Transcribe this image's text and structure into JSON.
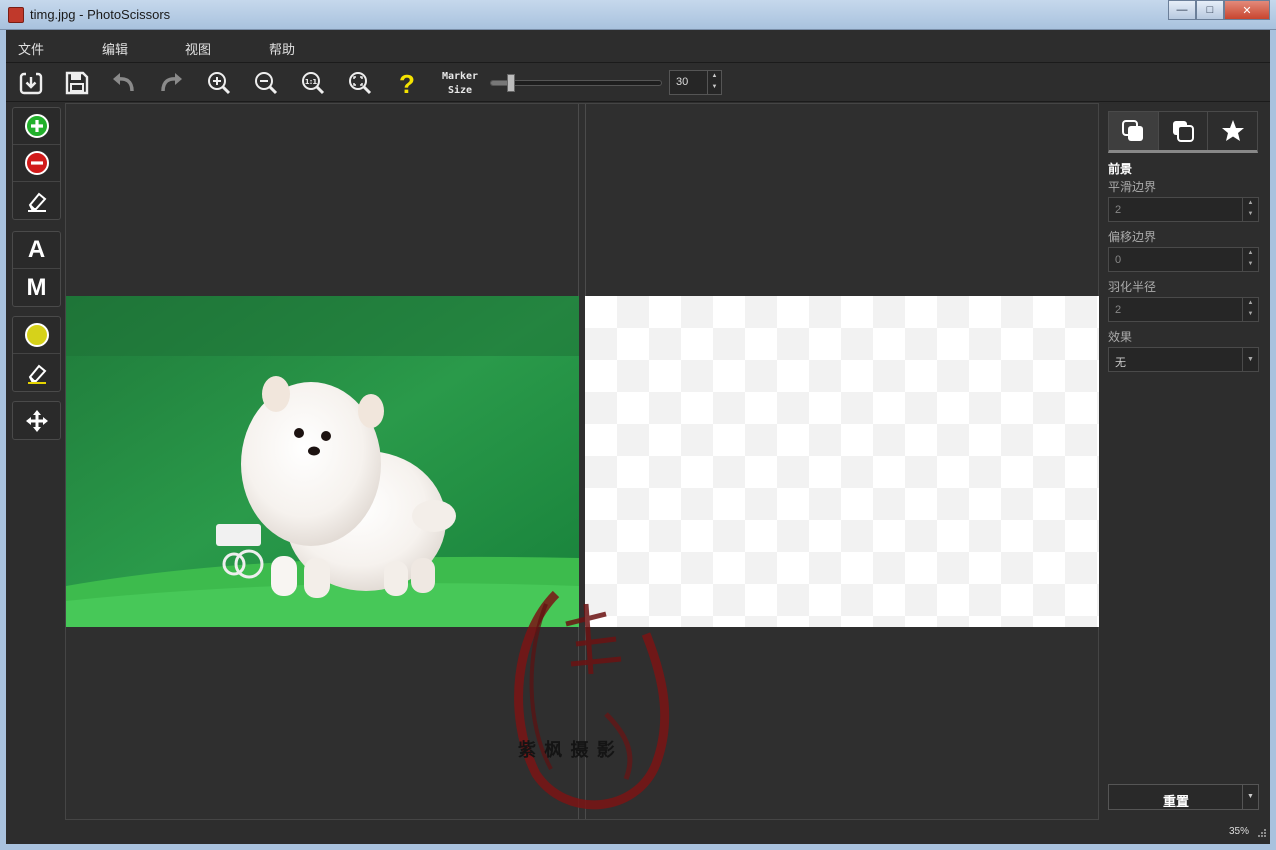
{
  "window": {
    "title": "timg.jpg - PhotoScissors"
  },
  "menu": {
    "file": "文件",
    "edit": "编辑",
    "view": "视图",
    "help": "帮助"
  },
  "toolbar": {
    "marker_label_1": "Marker",
    "marker_label_2": "Size",
    "marker_size_value": "30",
    "marker_size_fraction": 0.12,
    "help_color": "#f5e300"
  },
  "tools": {
    "keep": "A",
    "manual": "M"
  },
  "panel": {
    "section": "前景",
    "smooth_label": "平滑边界",
    "smooth_value": "2",
    "offset_label": "偏移边界",
    "offset_value": "0",
    "feather_label": "羽化半径",
    "feather_value": "2",
    "effect_label": "效果",
    "effect_value": "无",
    "reset": "重置"
  },
  "watermark": {
    "text": "紫 枫 摄 影",
    "seal": "紫枫"
  },
  "status": {
    "zoom": "35%"
  },
  "colors": {
    "accent_green": "#22b02c",
    "accent_red": "#d11a1a",
    "annotation_arrow": "#e8322a"
  }
}
